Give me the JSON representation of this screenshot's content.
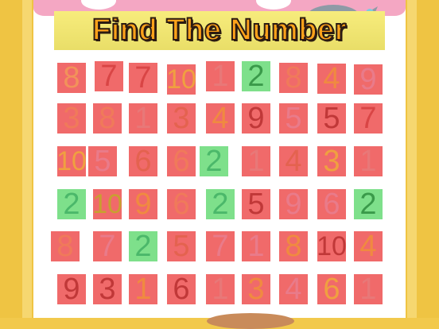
{
  "title": "Find The Number",
  "colors": {
    "red_cell": "#f06a6a",
    "green_cell": "#7ee08b",
    "frame": "#efc443",
    "pink": "#f4a7c3"
  },
  "grid": {
    "rows": [
      [
        {
          "n": "8",
          "bg": "red",
          "fg": "#f2925a"
        },
        {
          "n": "7",
          "bg": "red",
          "fg": "#d94545"
        },
        {
          "n": "7",
          "bg": "red",
          "fg": "#d94545"
        },
        {
          "n": "10",
          "bg": "red",
          "fg": "#f0a040"
        },
        {
          "n": "1",
          "bg": "red",
          "fg": "#e87878"
        },
        {
          "n": "2",
          "bg": "green",
          "fg": "#3a9a4a"
        },
        {
          "n": "8",
          "bg": "red",
          "fg": "#f07a5a"
        },
        {
          "n": "4",
          "bg": "red",
          "fg": "#f08a40"
        },
        {
          "n": "9",
          "bg": "red",
          "fg": "#e97b8a"
        }
      ],
      [
        {
          "n": "3",
          "bg": "red",
          "fg": "#f07a5a"
        },
        {
          "n": "8",
          "bg": "red",
          "fg": "#f07a5a"
        },
        {
          "n": "1",
          "bg": "red",
          "fg": "#e87878"
        },
        {
          "n": "3",
          "bg": "red",
          "fg": "#e4624f"
        },
        {
          "n": "4",
          "bg": "red",
          "fg": "#f08a40"
        },
        {
          "n": "9",
          "bg": "red",
          "fg": "#c03838"
        },
        {
          "n": "5",
          "bg": "red",
          "fg": "#e97b8a"
        },
        {
          "n": "5",
          "bg": "red",
          "fg": "#c03838"
        },
        {
          "n": "7",
          "bg": "red",
          "fg": "#d94545"
        }
      ],
      [
        {
          "n": "10",
          "bg": "red",
          "fg": "#f0a040"
        },
        {
          "n": "5",
          "bg": "red",
          "fg": "#e97b8a"
        },
        {
          "n": "6",
          "bg": "red",
          "fg": "#e4624f"
        },
        {
          "n": "6",
          "bg": "red",
          "fg": "#f07a5a"
        },
        {
          "n": "2",
          "bg": "green",
          "fg": "#4bb86a"
        },
        {
          "n": "1",
          "bg": "red",
          "fg": "#e87878"
        },
        {
          "n": "4",
          "bg": "red",
          "fg": "#e4624f"
        },
        {
          "n": "3",
          "bg": "red",
          "fg": "#f0a040"
        },
        {
          "n": "1",
          "bg": "red",
          "fg": "#e87878"
        }
      ],
      [
        {
          "n": "2",
          "bg": "green",
          "fg": "#4bb86a"
        },
        {
          "n": "10",
          "bg": "red",
          "fg": "#c8a030"
        },
        {
          "n": "9",
          "bg": "red",
          "fg": "#f08a40"
        },
        {
          "n": "6",
          "bg": "red",
          "fg": "#f07a5a"
        },
        {
          "n": "2",
          "bg": "green",
          "fg": "#4bb86a"
        },
        {
          "n": "5",
          "bg": "red",
          "fg": "#c03838"
        },
        {
          "n": "9",
          "bg": "red",
          "fg": "#e97b8a"
        },
        {
          "n": "6",
          "bg": "red",
          "fg": "#e97b8a"
        },
        {
          "n": "2",
          "bg": "green",
          "fg": "#3a9a4a"
        }
      ],
      [
        {
          "n": "8",
          "bg": "red",
          "fg": "#f07a5a"
        },
        {
          "n": "7",
          "bg": "red",
          "fg": "#e97b8a"
        },
        {
          "n": "2",
          "bg": "green",
          "fg": "#4bb86a"
        },
        {
          "n": "5",
          "bg": "red",
          "fg": "#e4624f"
        },
        {
          "n": "7",
          "bg": "red",
          "fg": "#e97b8a"
        },
        {
          "n": "1",
          "bg": "red",
          "fg": "#e97b8a"
        },
        {
          "n": "8",
          "bg": "red",
          "fg": "#f08a40"
        },
        {
          "n": "10",
          "bg": "red",
          "fg": "#c03838"
        },
        {
          "n": "4",
          "bg": "red",
          "fg": "#f08a40"
        }
      ],
      [
        {
          "n": "9",
          "bg": "red",
          "fg": "#c03838"
        },
        {
          "n": "3",
          "bg": "red",
          "fg": "#c03838"
        },
        {
          "n": "1",
          "bg": "red",
          "fg": "#f08a40"
        },
        {
          "n": "6",
          "bg": "red",
          "fg": "#c03838"
        },
        {
          "n": "1",
          "bg": "red",
          "fg": "#e87878"
        },
        {
          "n": "3",
          "bg": "red",
          "fg": "#f08a40"
        },
        {
          "n": "4",
          "bg": "red",
          "fg": "#e97b8a"
        },
        {
          "n": "6",
          "bg": "red",
          "fg": "#f0a040"
        },
        {
          "n": "1",
          "bg": "red",
          "fg": "#e87878"
        }
      ]
    ]
  }
}
